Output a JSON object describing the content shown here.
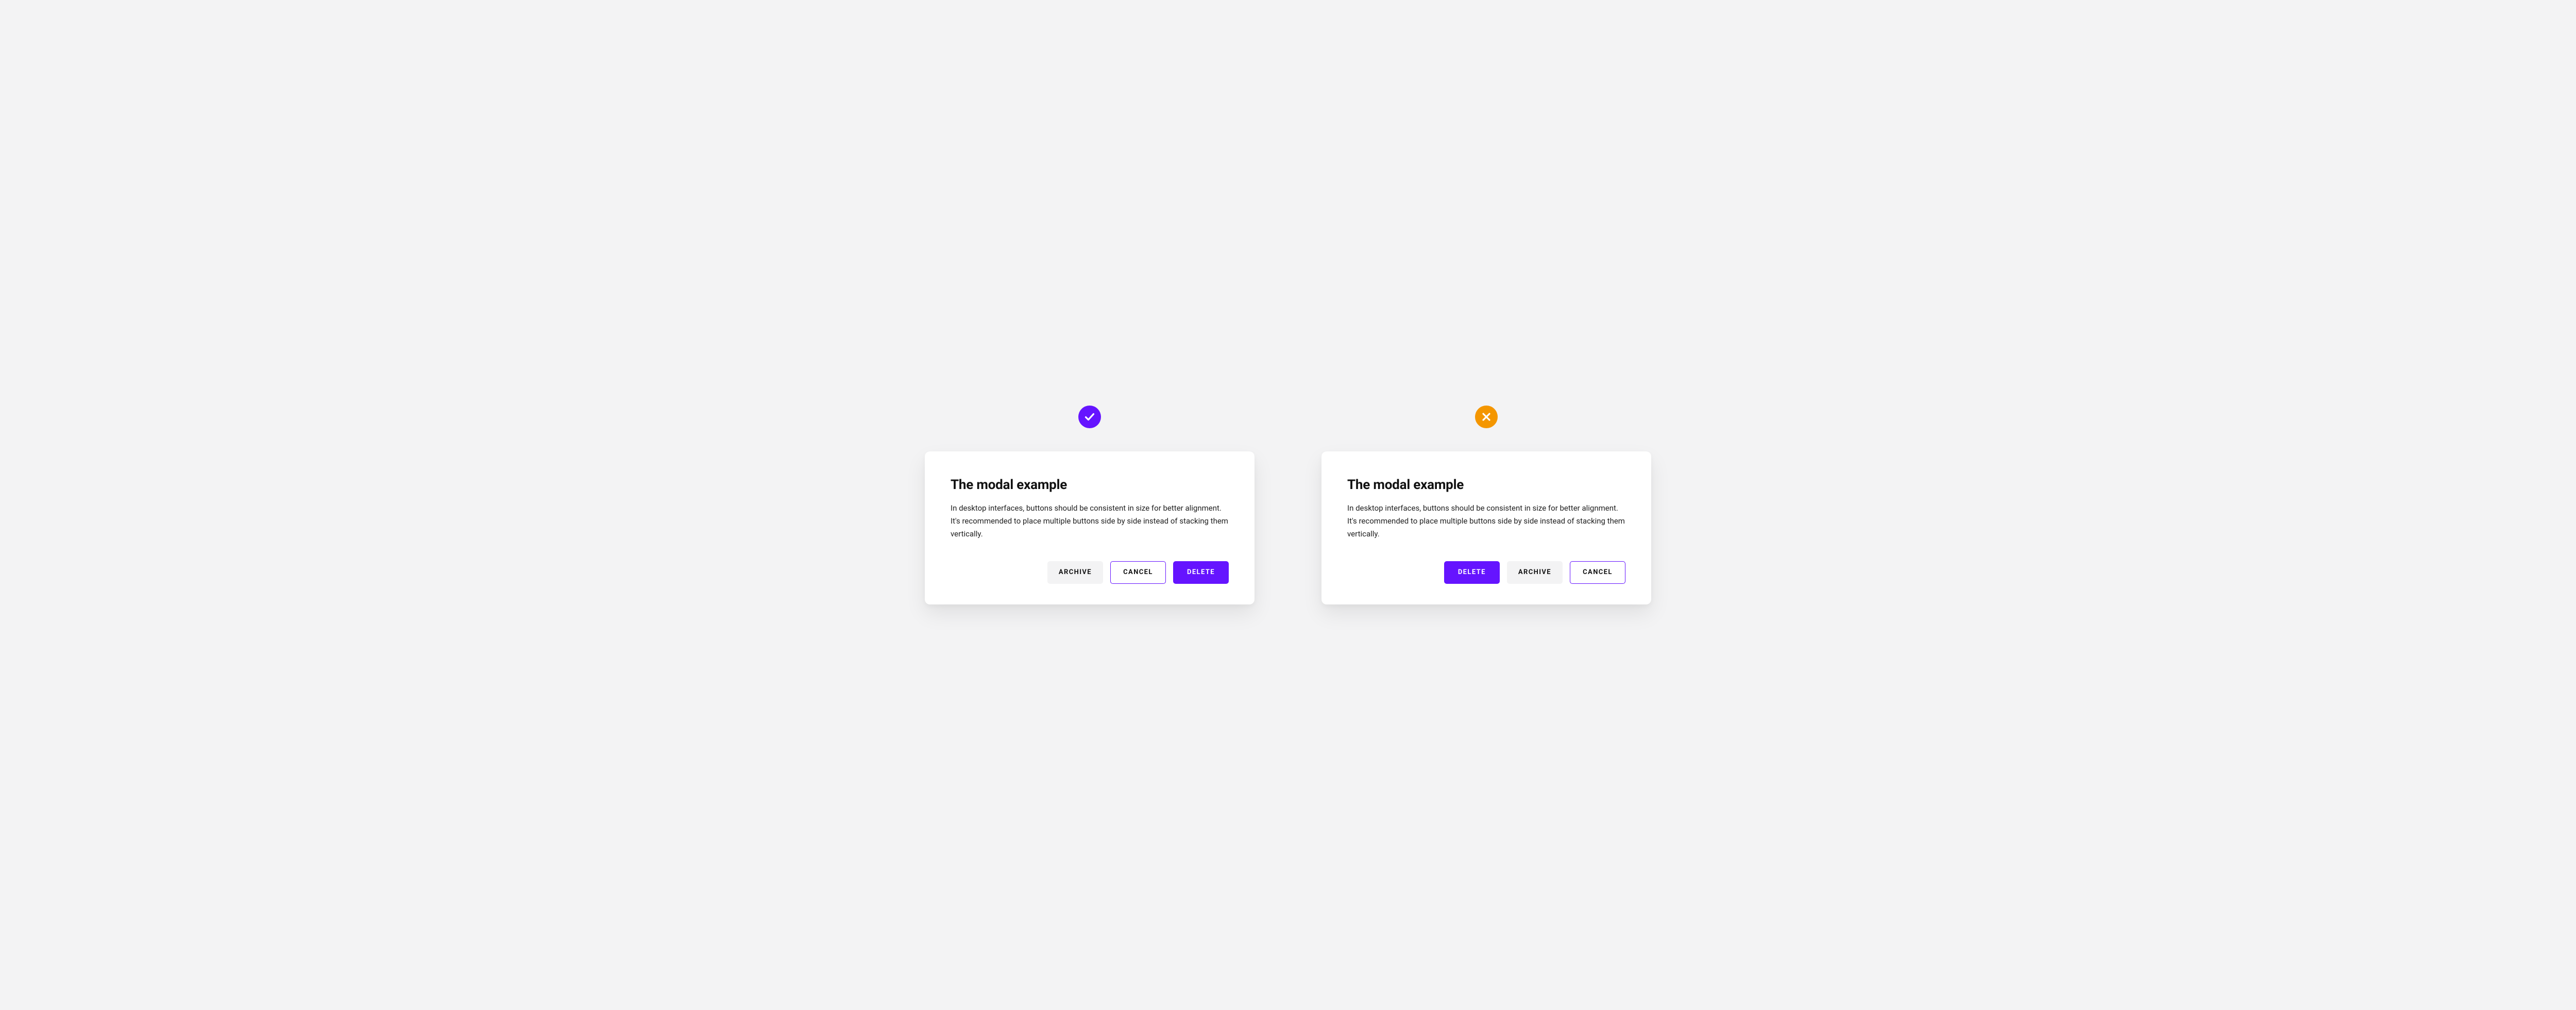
{
  "good": {
    "badge": "check-icon",
    "title": "The modal example",
    "body": "In desktop interfaces, buttons should be consistent in size for better alignment. It's recommended to place multiple buttons side by side instead of stacking them vertically.",
    "buttons": {
      "archive": "ARCHIVE",
      "cancel": "CANCEL",
      "delete": "DELETE"
    }
  },
  "bad": {
    "badge": "x-icon",
    "title": "The modal example",
    "body": "In desktop interfaces, buttons should be consistent in size for better alignment. It's recommended to place multiple buttons side by side instead of stacking them vertically.",
    "buttons": {
      "delete": "DELETE",
      "archive": "ARCHIVE",
      "cancel": "CANCEL"
    }
  },
  "colors": {
    "accent": "#6514ff",
    "warning": "#f49600",
    "surface": "#ffffff",
    "bg": "#f3f3f4"
  }
}
